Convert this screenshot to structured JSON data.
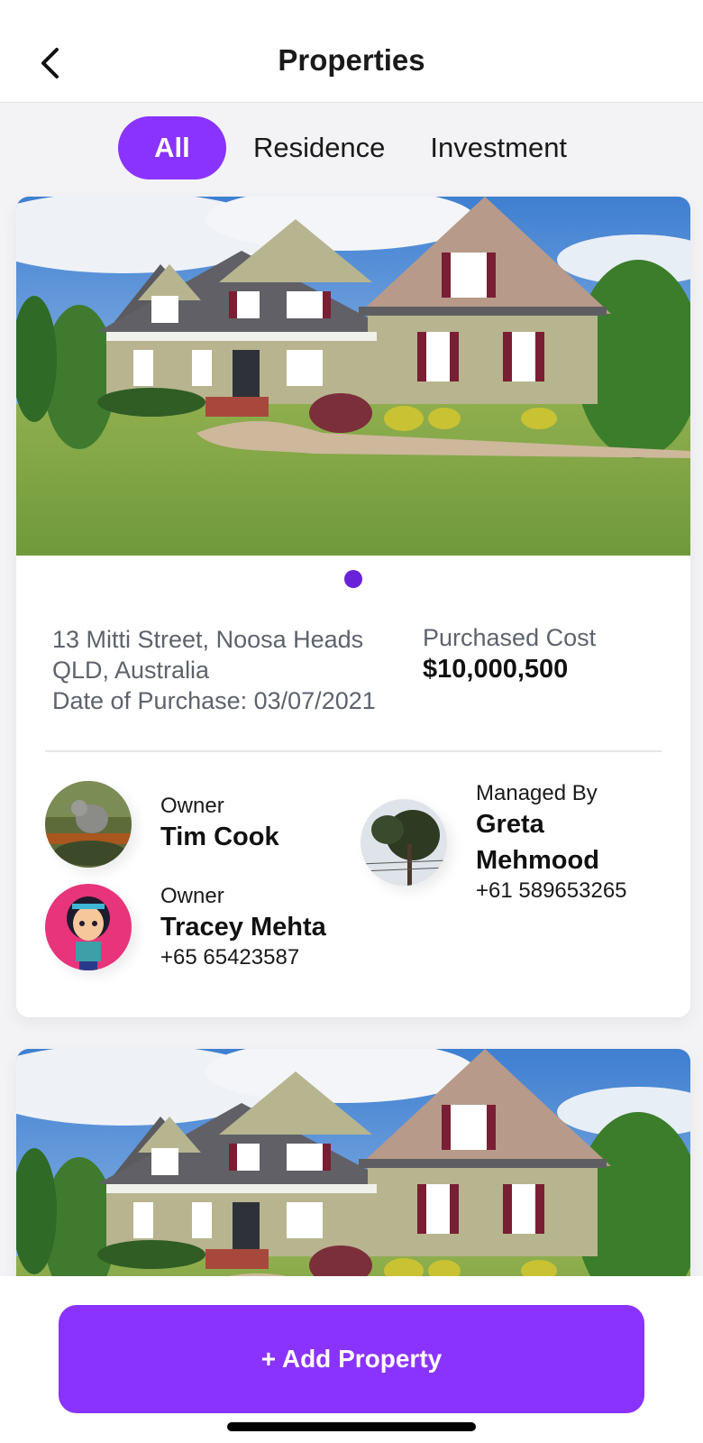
{
  "header": {
    "title": "Properties",
    "back_icon": "chevron-left-icon"
  },
  "tabs": [
    {
      "label": "All",
      "active": true
    },
    {
      "label": "Residence",
      "active": false
    },
    {
      "label": "Investment",
      "active": false
    }
  ],
  "properties": [
    {
      "address_line1": "13 Mitti Street, Noosa Heads",
      "address_line2": "QLD, Australia",
      "purchase_date": "Date of Purchase: 03/07/2021",
      "cost_label": "Purchased Cost",
      "cost_value": "$10,000,500",
      "image": "house-photo",
      "people": [
        {
          "role": "Owner",
          "name": "Tim Cook",
          "phone": ""
        },
        {
          "role": "Owner",
          "name": "Tracey Mehta",
          "phone": "+65 65423587"
        },
        {
          "role": "Managed By",
          "name": "Greta Mehmood",
          "phone": "+61 589653265"
        }
      ]
    },
    {
      "image": "house-photo"
    }
  ],
  "footer": {
    "add_label": "+ Add Property"
  },
  "colors": {
    "accent": "#8a33ff",
    "dot": "#6a22d9"
  }
}
